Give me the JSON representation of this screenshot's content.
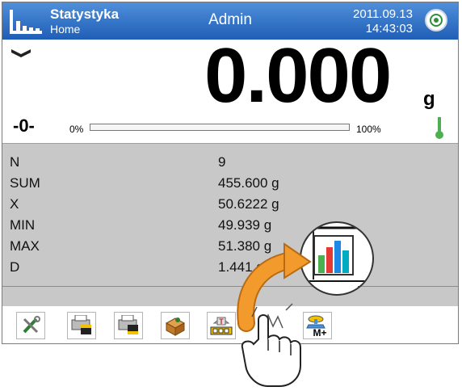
{
  "header": {
    "title": "Statystyka",
    "subtitle": "Home",
    "user": "Admin",
    "date": "2011.09.13",
    "time": "14:43:03"
  },
  "display": {
    "weight": "0.000",
    "unit": "g",
    "zero_indicator": "-0-",
    "bar_min_label": "0%",
    "bar_max_label": "100%",
    "bar_fill_percent": 0
  },
  "stats": [
    {
      "key": "N",
      "value": "9"
    },
    {
      "key": "SUM",
      "value": "455.600 g"
    },
    {
      "key": "X",
      "value": "50.6222 g"
    },
    {
      "key": "MIN",
      "value": "49.939 g"
    },
    {
      "key": "MAX",
      "value": "51.380 g"
    },
    {
      "key": "D",
      "value": "1.441 g"
    }
  ],
  "toolbar": {
    "buttons": [
      "settings-tools-icon",
      "print-header-icon",
      "print-footer-icon",
      "database-box-icon",
      "tare-icon",
      "statistics-add-icon"
    ],
    "m_plus_label": "M+",
    "tare_label": "T"
  },
  "colors": {
    "header_top": "#4f8fda",
    "header_bottom": "#1f5eb6",
    "stats_bg": "#c8c8c8",
    "arrow": "#f39a2c"
  }
}
